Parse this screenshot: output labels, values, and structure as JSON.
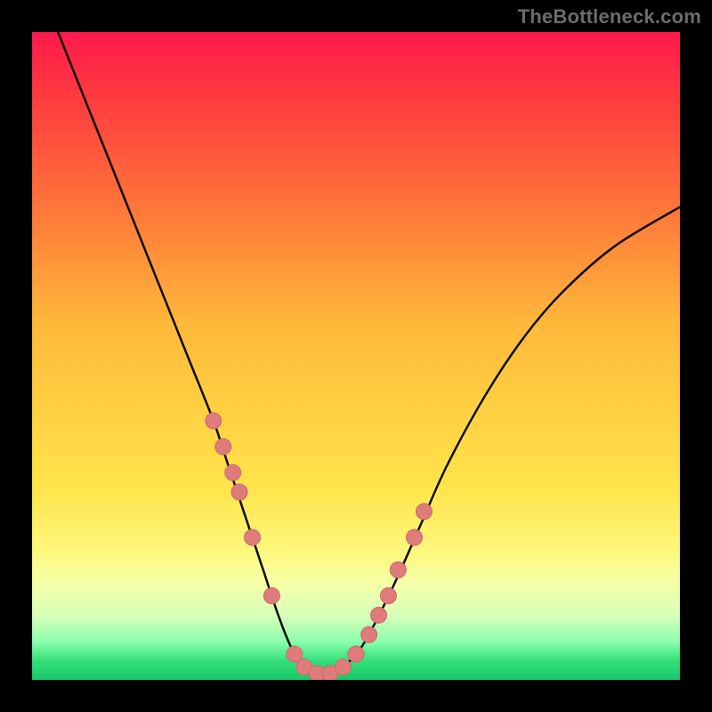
{
  "attribution": "TheBottleneck.com",
  "colors": {
    "frame": "#000000",
    "curve": "#000000",
    "marker": "#e07b7b",
    "marker_stroke": "#c96a6a",
    "gradient_top": "#ff1a4d",
    "gradient_bottom": "#19c76a"
  },
  "chart_data": {
    "type": "line",
    "title": "",
    "xlabel": "",
    "ylabel": "",
    "xlim": [
      0,
      100
    ],
    "ylim": [
      0,
      100
    ],
    "series": [
      {
        "name": "bottleneck-curve",
        "x": [
          4,
          8,
          12,
          16,
          20,
          24,
          28,
          30,
          32,
          34,
          36,
          38,
          40,
          42,
          44,
          46,
          48,
          50,
          52,
          56,
          60,
          64,
          70,
          76,
          82,
          90,
          100
        ],
        "y": [
          100,
          90,
          80,
          70,
          60,
          50,
          40,
          34,
          28,
          22,
          16,
          10,
          5,
          2,
          1,
          1,
          2,
          4,
          7,
          15,
          24,
          33,
          44,
          53,
          60,
          67,
          73
        ]
      }
    ],
    "markers": {
      "name": "highlight-points",
      "x": [
        28,
        29.5,
        31,
        32,
        34,
        37,
        40.5,
        42,
        44,
        46,
        48,
        50,
        52,
        53.5,
        55,
        56.5,
        59,
        60.5
      ],
      "y": [
        40,
        36,
        32,
        29,
        22,
        13,
        4,
        2,
        1,
        1,
        2,
        4,
        7,
        10,
        13,
        17,
        22,
        26
      ]
    }
  }
}
